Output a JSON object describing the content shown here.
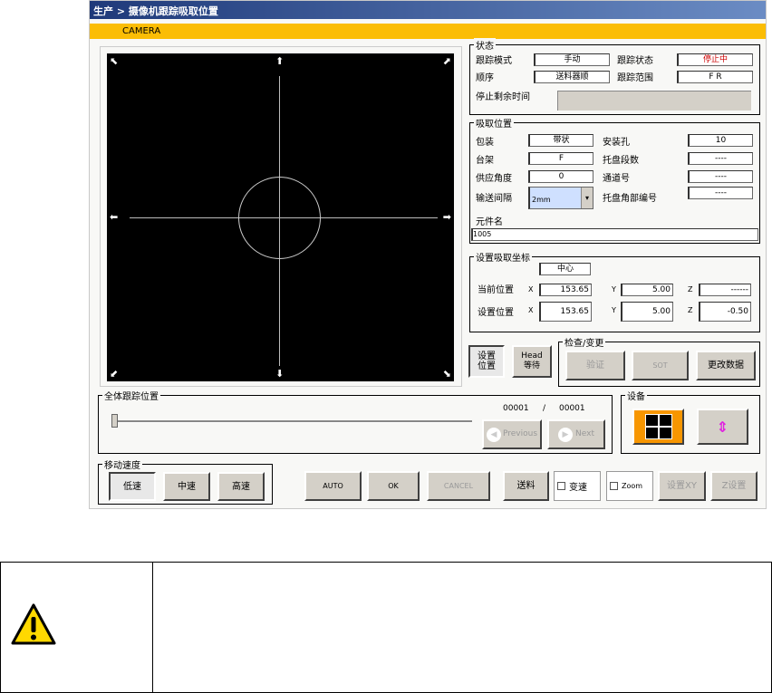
{
  "title": "生产 > 摄像机跟踪吸取位置",
  "camera_label": "CAMERA",
  "status": {
    "legend": "状态",
    "mode_label": "跟踪模式",
    "mode_value": "手动",
    "state_label": "跟踪状态",
    "state_value": "停止中",
    "state_color": "#cc0000",
    "order_label": "顺序",
    "order_value": "送料器顺",
    "range_label": "跟踪范围",
    "range_value": "F R",
    "remaining_label": "停止剩余时间",
    "remaining_value": ""
  },
  "pickup": {
    "legend": "吸取位置",
    "package_label": "包装",
    "package_value": "带状",
    "hole_label": "安装孔",
    "hole_value": "10",
    "stage_label": "台架",
    "stage_value": "F",
    "tray_levels_label": "托盘段数",
    "tray_levels_value": "----",
    "angle_label": "供应角度",
    "angle_value": "0",
    "lane_label": "通道号",
    "lane_value": "----",
    "pitch_label": "输送间隔",
    "pitch_value": "2mm",
    "tray_corner_label": "托盘角部编号",
    "tray_corner_value": "----",
    "part_label": "元件名",
    "part_value": "1005"
  },
  "coords": {
    "legend": "设置吸取坐标",
    "ref": "中心",
    "current_label": "当前位置",
    "set_label": "设置位置",
    "x": "X",
    "y": "Y",
    "z": "Z",
    "current": {
      "x": "153.65",
      "y": "5.00",
      "z": "------"
    },
    "set": {
      "x": "153.65",
      "y": "5.00",
      "z": "-0.50"
    }
  },
  "buttons": {
    "set_pos": "设置位置",
    "head_wait": "Head 等待",
    "verify": "验证",
    "sot": "SOT",
    "change_data": "更改数据",
    "previous": "Previous",
    "next": "Next",
    "low": "低速",
    "mid": "中速",
    "high": "高速",
    "auto": "AUTO",
    "ok": "OK",
    "cancel": "CANCEL",
    "feed": "送料",
    "speed_change": "变速",
    "zoom": "Zoom",
    "set_xy": "设置XY",
    "set_z": "Z设置"
  },
  "check_legend": "检查/变更",
  "device_legend": "设备",
  "tracking": {
    "legend": "全体跟踪位置",
    "current": "00001",
    "sep": "/",
    "total": "00001",
    "slider_fraction": 0
  },
  "speed_legend": "移动速度",
  "warning": {
    "text": ""
  }
}
